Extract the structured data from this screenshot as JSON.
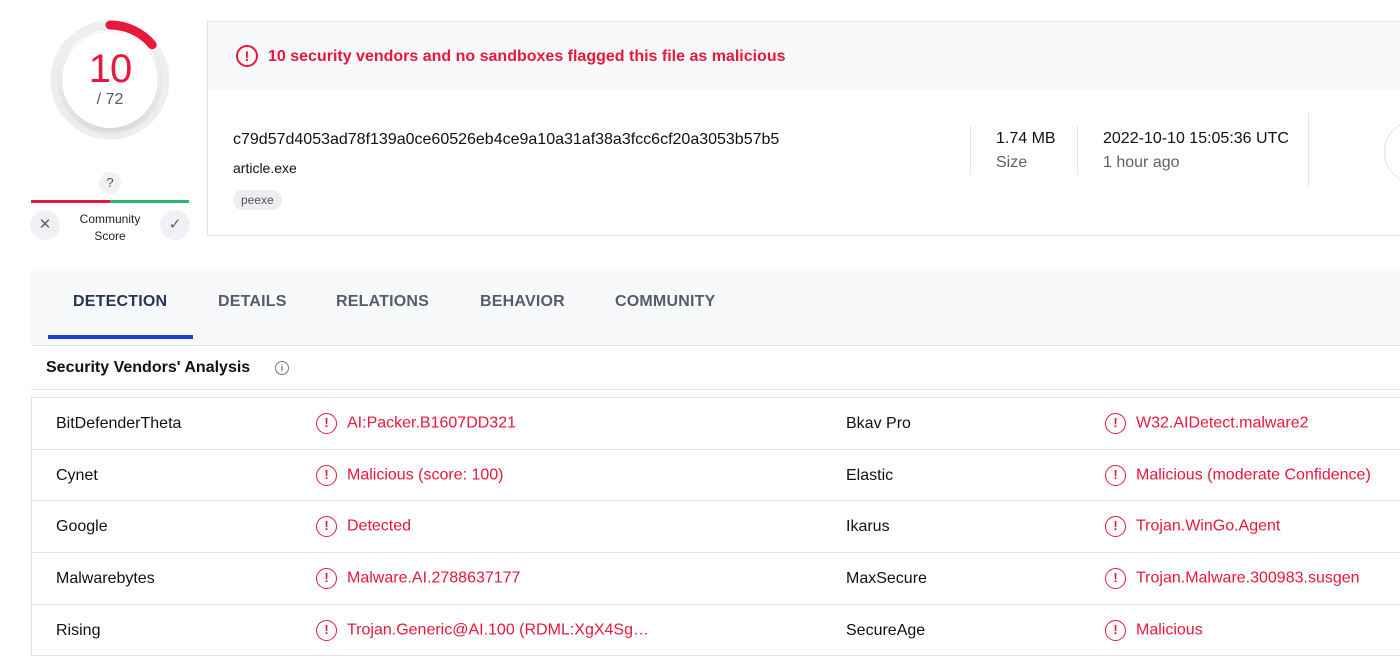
{
  "score": {
    "detections": "10",
    "total": "/ 72",
    "fraction": 0.139
  },
  "community": {
    "unknown_glyph": "?",
    "label_line1": "Community",
    "label_line2": "Score",
    "dislike_icon": "close-icon",
    "like_icon": "check-icon"
  },
  "banner": {
    "icon": "alert-circle-icon",
    "text": "10 security vendors and no sandboxes flagged this file as malicious"
  },
  "file": {
    "hash": "c79d57d4053ad78f139a0ce60526eb4ce9a10a31af38a3fcc6cf20a3053b57b5",
    "name": "article.exe",
    "tag": "peexe",
    "size_value": "1.74 MB",
    "size_label": "Size",
    "date_value": "2022-10-10 15:05:36 UTC",
    "date_relative": "1 hour ago"
  },
  "tabs": [
    {
      "label": "DETECTION",
      "active": true
    },
    {
      "label": "DETAILS"
    },
    {
      "label": "RELATIONS"
    },
    {
      "label": "BEHAVIOR"
    },
    {
      "label": "COMMUNITY"
    }
  ],
  "section": {
    "title": "Security Vendors' Analysis",
    "info_glyph": "i"
  },
  "vendors": [
    {
      "left_name": "BitDefenderTheta",
      "left_result": "AI:Packer.B1607DD321",
      "right_name": "Bkav Pro",
      "right_result": "W32.AIDetect.malware2"
    },
    {
      "left_name": "Cynet",
      "left_result": "Malicious (score: 100)",
      "right_name": "Elastic",
      "right_result": "Malicious (moderate Confidence)"
    },
    {
      "left_name": "Google",
      "left_result": "Detected",
      "right_name": "Ikarus",
      "right_result": "Trojan.WinGo.Agent"
    },
    {
      "left_name": "Malwarebytes",
      "left_result": "Malware.AI.2788637177",
      "right_name": "MaxSecure",
      "right_result": "Trojan.Malware.300983.susgen"
    },
    {
      "left_name": "Rising",
      "left_result": "Trojan.Generic@AI.100 (RDML:XgX4Sg…",
      "right_name": "SecureAge",
      "right_result": "Malicious"
    }
  ],
  "colors": {
    "malicious": "#e8173c",
    "harmless": "#2bb673",
    "tab_active_indicator": "#1f3fd6"
  }
}
